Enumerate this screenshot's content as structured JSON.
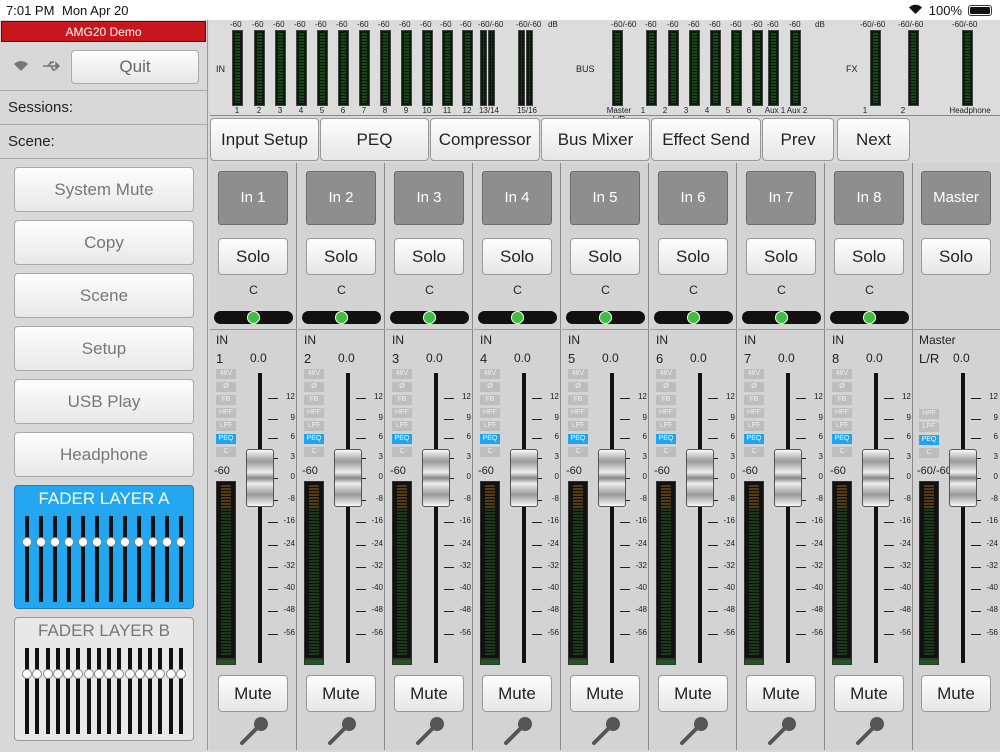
{
  "status_bar": {
    "time": "7:01 PM",
    "date": "Mon Apr 20",
    "battery": "100%"
  },
  "left": {
    "device_name": "AMG20 Demo",
    "quit_label": "Quit",
    "sessions_label": "Sessions:",
    "scene_label": "Scene:",
    "buttons": [
      "System Mute",
      "Copy",
      "Scene",
      "Setup",
      "USB Play",
      "Headphone"
    ],
    "layer_a": {
      "title": "FADER LAYER A",
      "levels": [
        0.3,
        0.3,
        0.3,
        0.3,
        0.3,
        0.3,
        0.3,
        0.3,
        0.3,
        0.3,
        0.3,
        0.3
      ]
    },
    "layer_b": {
      "title": "FADER LAYER B",
      "levels": [
        0.3,
        0.3,
        0.3,
        0.3,
        0.3,
        0.3,
        0.3,
        0.3,
        0.3,
        0.3,
        0.3,
        0.3,
        0.3,
        0.3,
        0.3,
        0.3
      ]
    }
  },
  "meters": {
    "in": {
      "label": "IN",
      "channels": [
        "1",
        "2",
        "3",
        "4",
        "5",
        "6",
        "7",
        "8",
        "9",
        "10",
        "11",
        "12",
        "13/14",
        "15/16"
      ]
    },
    "bus": {
      "label": "BUS",
      "channels": [
        "Master L/R",
        "1",
        "2",
        "3",
        "4",
        "5",
        "6",
        "Aux 1",
        "Aux 2"
      ]
    },
    "fx": {
      "label": "FX",
      "channels": [
        "1",
        "2",
        "Headphone"
      ]
    },
    "db_label": "dB",
    "scale_mark": "-60",
    "stereo_scale_mark": "-60/-60"
  },
  "tabs": [
    "Input Setup",
    "PEQ",
    "Compressor",
    "Bus Mixer",
    "Effect Send",
    "Prev",
    "Next"
  ],
  "channel_common": {
    "solo": "Solo",
    "mute": "Mute",
    "pan": "C",
    "source": "IN",
    "level": "0.0",
    "meter_floor": "-60",
    "flags": [
      "48V",
      "Ø",
      "FB",
      "HPF",
      "LPF",
      "PEQ",
      "C"
    ],
    "scale": [
      "12",
      "9",
      "6",
      "3",
      "0",
      "-8",
      "-16",
      "-24",
      "-32",
      "-40",
      "-48",
      "-56"
    ]
  },
  "channels": [
    {
      "name": "In 1",
      "number": "1",
      "fader_db": 0.0
    },
    {
      "name": "In 2",
      "number": "2",
      "fader_db": 0.0
    },
    {
      "name": "In 3",
      "number": "3",
      "fader_db": 0.0
    },
    {
      "name": "In 4",
      "number": "4",
      "fader_db": 0.0
    },
    {
      "name": "In 5",
      "number": "5",
      "fader_db": 0.0
    },
    {
      "name": "In 6",
      "number": "6",
      "fader_db": 0.0
    },
    {
      "name": "In 7",
      "number": "7",
      "fader_db": 0.0
    },
    {
      "name": "In 8",
      "number": "8",
      "fader_db": 0.0
    }
  ],
  "master": {
    "name": "Master",
    "source": "Master",
    "number": "L/R",
    "level": "0.0",
    "meter_floor": "-60/-60",
    "fader_db": 0.0,
    "flags": [
      "HPF",
      "LPF",
      "PEQ",
      "C"
    ]
  }
}
